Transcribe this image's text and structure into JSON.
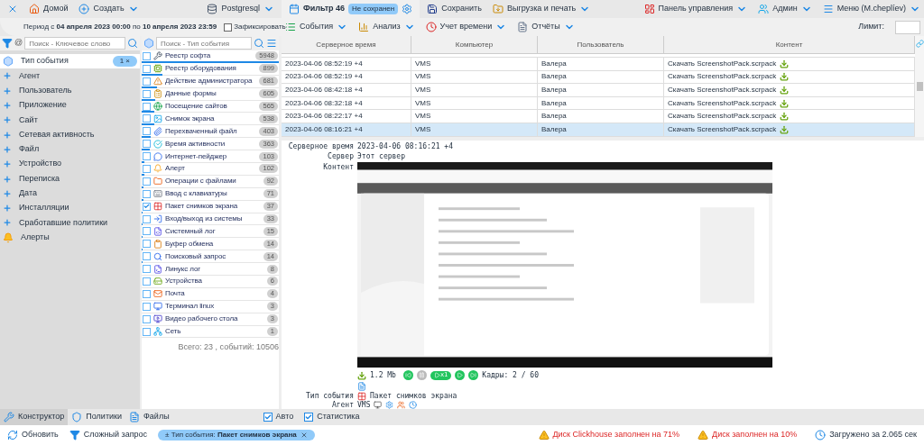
{
  "top_bar": {
    "home": "Домой",
    "create": "Создать",
    "database": "Postgresql",
    "filter_tab": {
      "label": "Фильтр 46",
      "badge": "Не сохранен"
    },
    "save": "Сохранить",
    "export": "Выгрузка и печать",
    "control_panel": "Панель управления",
    "admin": "Админ",
    "menu": "Меню (M.cheplíev)"
  },
  "period": {
    "prefix": "Период с ",
    "from": "04 апреля 2023 00:00",
    "middle": " по ",
    "to": "10 апреля 2023 23:59",
    "fix_label": "Зафиксировать",
    "fixed": false
  },
  "toolbar": {
    "items": [
      "События",
      "Анализ",
      "Учет времени",
      "Отчёты"
    ],
    "limit_label": "Лимит:"
  },
  "keyword_search": {
    "prefix": "@",
    "placeholder": "Поиск - Ключевое слово"
  },
  "event_search": {
    "placeholder": "Поиск - Тип события"
  },
  "filters": [
    {
      "label": "Тип события",
      "kind": "active",
      "badge": "1 ×"
    },
    {
      "label": "Агент",
      "kind": "category"
    },
    {
      "label": "Пользователь",
      "kind": "category"
    },
    {
      "label": "Приложение",
      "kind": "category"
    },
    {
      "label": "Сайт",
      "kind": "category"
    },
    {
      "label": "Сетевая активность",
      "kind": "category"
    },
    {
      "label": "Файл",
      "kind": "category"
    },
    {
      "label": "Устройство",
      "kind": "category"
    },
    {
      "label": "Переписка",
      "kind": "category"
    },
    {
      "label": "Дата",
      "kind": "category"
    },
    {
      "label": "Инсталляции",
      "kind": "category"
    },
    {
      "label": "Сработавшие политики",
      "kind": "category"
    },
    {
      "label": "Алерты",
      "kind": "alerts"
    }
  ],
  "event_types": [
    {
      "label": "Реестр софта",
      "count": "5948",
      "checked": false,
      "level": 1
    },
    {
      "label": "Реестр оборудования",
      "count": "899",
      "checked": false,
      "level": 0.15
    },
    {
      "label": "Действие администратора",
      "count": "681",
      "checked": false,
      "level": 0.114
    },
    {
      "label": "Данные формы",
      "count": "605",
      "checked": false,
      "level": 0.1
    },
    {
      "label": "Посещение сайтов",
      "count": "565",
      "checked": false,
      "level": 0.095
    },
    {
      "label": "Снимок экрана",
      "count": "538",
      "checked": false,
      "level": 0.09
    },
    {
      "label": "Перехваченный файл",
      "count": "403",
      "checked": false,
      "level": 0.068
    },
    {
      "label": "Время активности",
      "count": "363",
      "checked": false,
      "level": 0.061
    },
    {
      "label": "Интернет-пейджер",
      "count": "103",
      "checked": false,
      "level": 0.017
    },
    {
      "label": "Алерт",
      "count": "102",
      "checked": false,
      "level": 0.017
    },
    {
      "label": "Операции с файлами",
      "count": "92",
      "checked": false,
      "level": 0.015
    },
    {
      "label": "Ввод с клавиатуры",
      "count": "71",
      "checked": false,
      "level": 0.012
    },
    {
      "label": "Пакет снимков экрана",
      "count": "37",
      "checked": true,
      "level": 0.006
    },
    {
      "label": "Вход/выход из системы",
      "count": "33",
      "checked": false,
      "level": 0.006
    },
    {
      "label": "Системный лог",
      "count": "15",
      "checked": false,
      "level": 0.003
    },
    {
      "label": "Буфер обмена",
      "count": "14",
      "checked": false,
      "level": 0.002
    },
    {
      "label": "Поисковый запрос",
      "count": "14",
      "checked": false,
      "level": 0.002
    },
    {
      "label": "Линукс лог",
      "count": "8",
      "checked": false,
      "level": 0
    },
    {
      "label": "Устройства",
      "count": "6",
      "checked": false,
      "level": 0
    },
    {
      "label": "Почта",
      "count": "4",
      "checked": false,
      "level": 0
    },
    {
      "label": "Терминал linux",
      "count": "3",
      "checked": false,
      "level": 0
    },
    {
      "label": "Видео рабочего стола",
      "count": "3",
      "checked": false,
      "level": 0
    },
    {
      "label": "Сеть",
      "count": "1",
      "checked": false,
      "level": 0
    }
  ],
  "event_total": "Всего: 23 , событий: 10506",
  "table": {
    "columns": [
      "Серверное время",
      "Компьютер",
      "Пользователь",
      "Контент"
    ],
    "rows": [
      {
        "cells": [
          "2023-04-06 08:52:19 +4",
          "VMS",
          "Валера",
          "Скачать ScreenshotPack.scrpack"
        ],
        "selected": false
      },
      {
        "cells": [
          "2023-04-06 08:52:19 +4",
          "VMS",
          "Валера",
          "Скачать ScreenshotPack.scrpack"
        ],
        "selected": false
      },
      {
        "cells": [
          "2023-04-06 08:42:18 +4",
          "VMS",
          "Валера",
          "Скачать ScreenshotPack.scrpack"
        ],
        "selected": false
      },
      {
        "cells": [
          "2023-04-06 08:32:18 +4",
          "VMS",
          "Валера",
          "Скачать ScreenshotPack.scrpack"
        ],
        "selected": false
      },
      {
        "cells": [
          "2023-04-06 08:22:17 +4",
          "VMS",
          "Валера",
          "Скачать ScreenshotPack.scrpack"
        ],
        "selected": false
      },
      {
        "cells": [
          "2023-04-06 08:16:21 +4",
          "VMS",
          "Валера",
          "Скачать ScreenshotPack.scrpack"
        ],
        "selected": true
      }
    ]
  },
  "details": {
    "server_time_label": "Серверное время",
    "server_time": "2023-04-06 08:16:21 +4",
    "server_label": "Сервер",
    "server": "Этот сервер",
    "content_label": "Контент",
    "size": "1.2 Mb",
    "speed": "x1",
    "frames": "Кадры: 2 / 60",
    "event_type_label": "Тип события",
    "event_type": "Пакет снимков экрана",
    "agent_label": "Агент",
    "agent": "VMS"
  },
  "bottom_tabs": [
    {
      "label": "Конструктор",
      "selected": true
    },
    {
      "label": "Политики",
      "selected": false
    },
    {
      "label": "Файлы",
      "selected": false
    }
  ],
  "options": [
    {
      "label": "Авто",
      "checked": true
    },
    {
      "label": "Статистика",
      "checked": true
    }
  ],
  "status_bar": {
    "refresh": "Обновить",
    "complex_query": "Сложный запрос",
    "chip": "± Тип события: **Пакет снимков экрана**",
    "warnings": [
      "Диск Clickhouse заполнен на 71%",
      "Диск заполнен на 10%"
    ],
    "loaded": "Загружено за 2.065 сек"
  }
}
